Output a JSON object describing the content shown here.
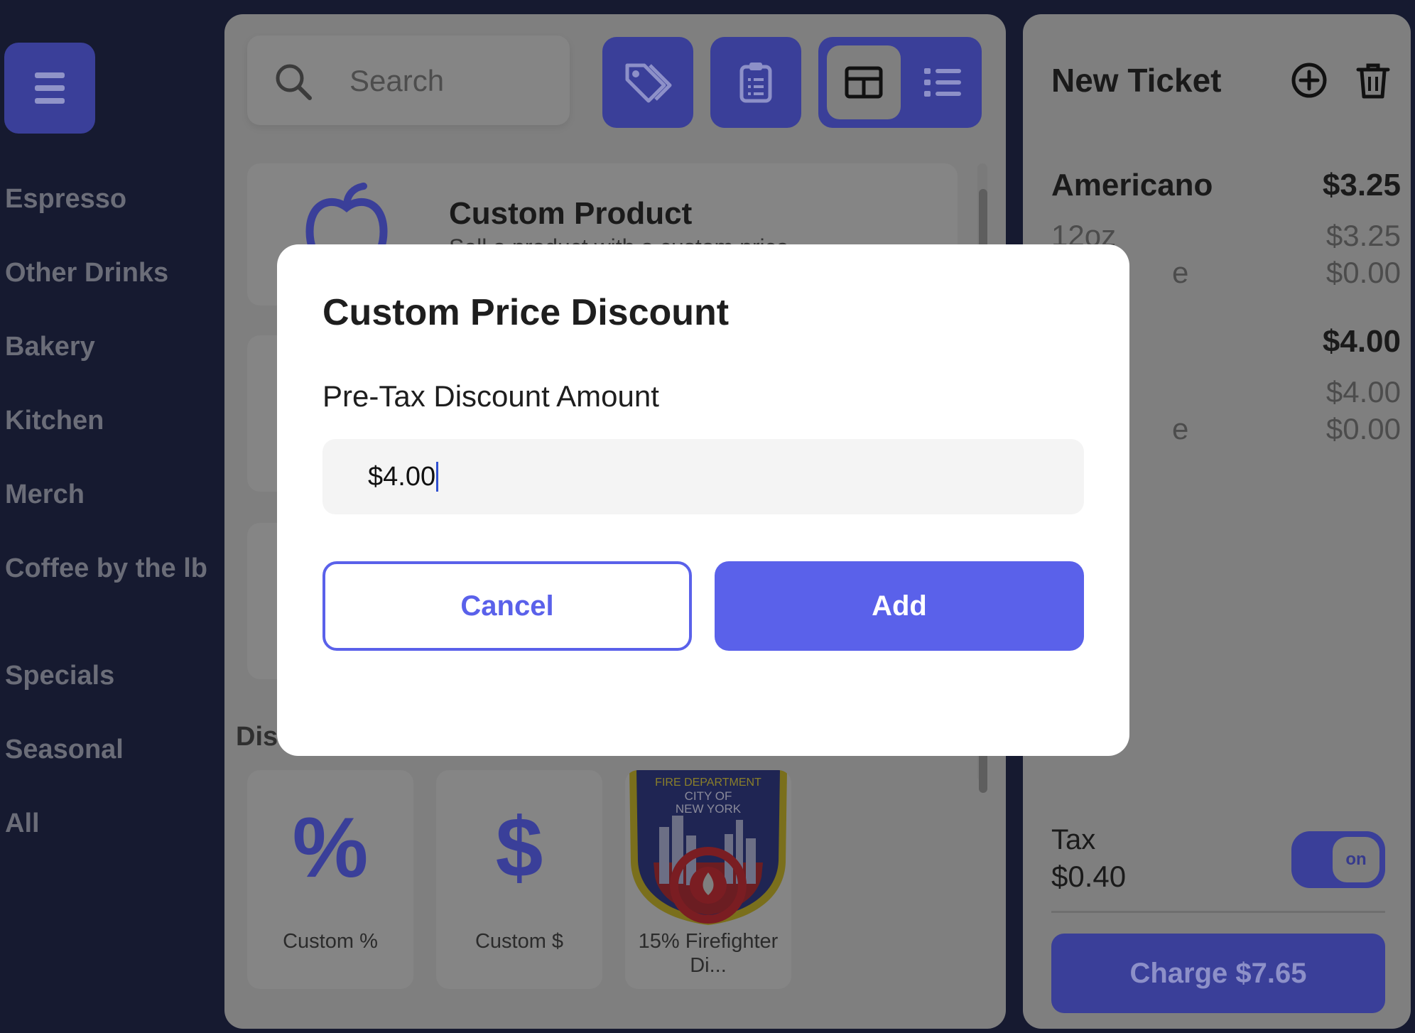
{
  "sidebar": {
    "categories": [
      {
        "label": "Espresso"
      },
      {
        "label": "Other Drinks"
      },
      {
        "label": "Bakery"
      },
      {
        "label": "Kitchen"
      },
      {
        "label": "Merch"
      },
      {
        "label": "Coffee by the lb"
      },
      {
        "label": "Specials"
      },
      {
        "label": "Seasonal"
      },
      {
        "label": "All"
      }
    ]
  },
  "toolbar": {
    "search_placeholder": "Search",
    "icons": [
      "search-icon",
      "tag-icon",
      "clipboard-icon",
      "grid-view-icon",
      "list-view-icon"
    ],
    "active_view": "grid"
  },
  "products": {
    "custom_product": {
      "title": "Custom Product",
      "subtitle": "Sell a product with a custom price"
    }
  },
  "discounts": {
    "section_heading": "Dis",
    "items": [
      {
        "label": "Custom %",
        "glyph": "%"
      },
      {
        "label": "Custom $",
        "glyph": "$"
      },
      {
        "label": "15% Firefighter Di...",
        "badge_text_top": "FIRE DEPARTMENT",
        "badge_text_mid1": "CITY OF",
        "badge_text_mid2": "NEW YORK"
      }
    ]
  },
  "ticket": {
    "title": "New Ticket",
    "lines": [
      {
        "name": "Americano",
        "price": "$3.25",
        "sub": [
          {
            "name": "12oz",
            "price": "$3.25"
          },
          {
            "name": "e",
            "price": "$0.00"
          }
        ]
      },
      {
        "name": "",
        "price": "$4.00",
        "sub": [
          {
            "name": "",
            "price": "$4.00"
          },
          {
            "name": "e",
            "price": "$0.00"
          }
        ]
      }
    ],
    "tax_label": "Tax",
    "tax_value": "$0.40",
    "tax_toggle": "on",
    "charge_label": "Charge $7.65"
  },
  "modal": {
    "title": "Custom Price Discount",
    "field_label": "Pre-Tax Discount Amount",
    "amount_value": "$4.00",
    "cancel_label": "Cancel",
    "add_label": "Add"
  },
  "colors": {
    "background": "#161a30",
    "accent_dim": "#3a3f99",
    "accent": "#5a61ea",
    "overlay_panel": "#7f7f7f"
  }
}
